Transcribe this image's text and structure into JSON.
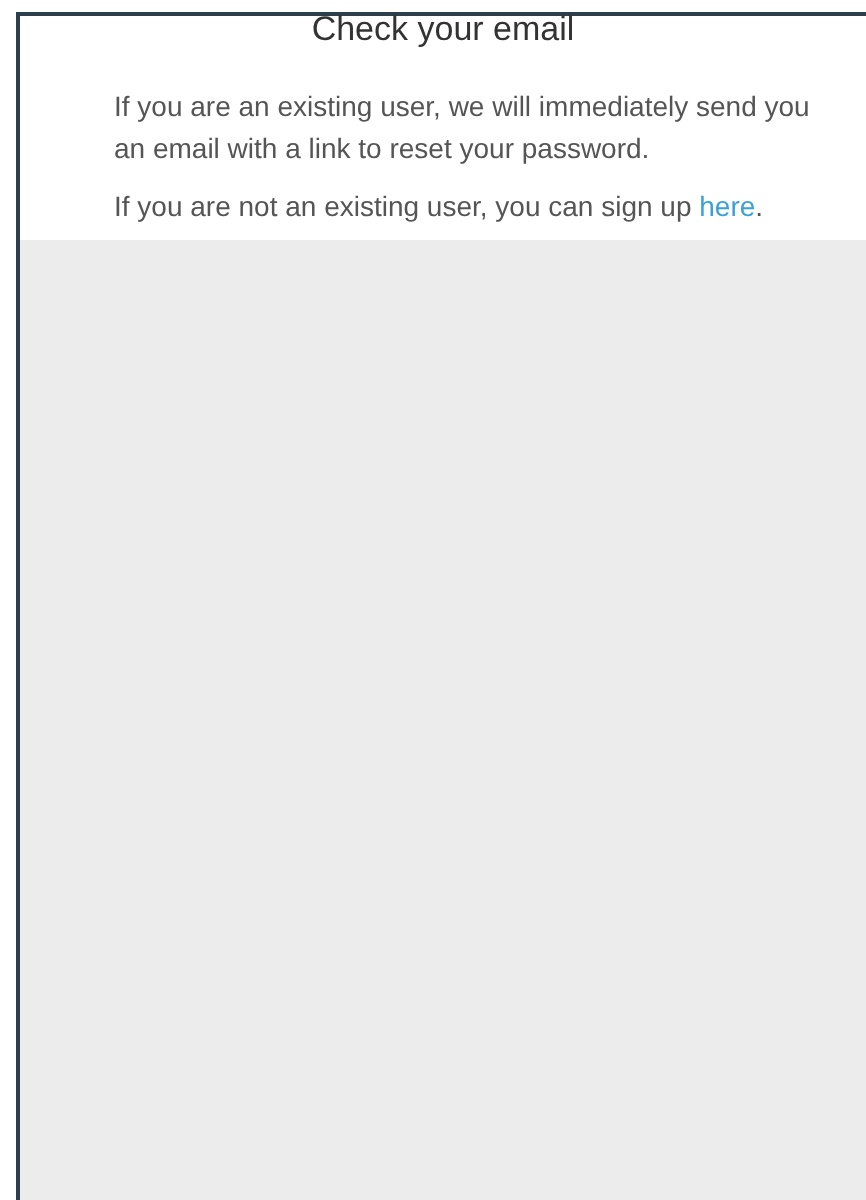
{
  "title": "Check your email",
  "paragraphs": [
    {
      "kind": "text",
      "text": "If you are an existing user, we will immediately send you an email with a link to reset your password."
    },
    {
      "kind": "link",
      "text": "If you are not an existing user, you can sign up ",
      "link": "here",
      "after": "."
    }
  ]
}
